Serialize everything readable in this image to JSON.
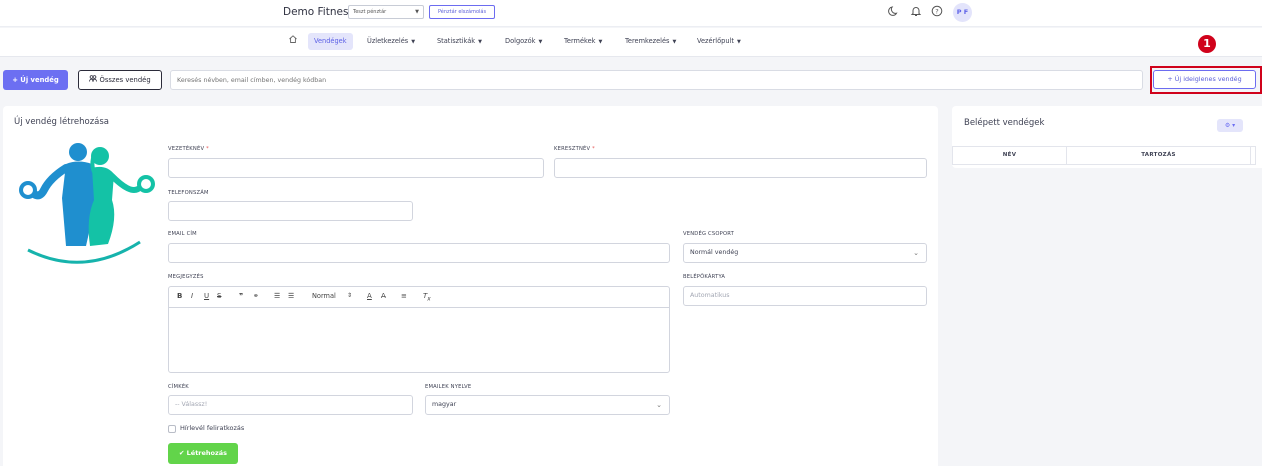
{
  "header": {
    "brand": "Demo Fitness",
    "cash_register": "Teszt pénztár",
    "cash_register_button": "Pénztár elszámolás",
    "avatar_initials": "P F"
  },
  "nav": {
    "items": [
      {
        "label": "Vendégek",
        "active": true
      },
      {
        "label": "Üzletkezelés"
      },
      {
        "label": "Statisztikák"
      },
      {
        "label": "Dolgozók"
      },
      {
        "label": "Termékek"
      },
      {
        "label": "Teremkezelés"
      },
      {
        "label": "Vezérlőpult"
      }
    ]
  },
  "actions": {
    "new_guest": "+ Új vendég",
    "all_guests": "Összes vendég",
    "search_placeholder": "Keresés névben, email címben, vendég kódban",
    "new_temp_guest": "+ Új ideiglenes vendég",
    "marker": "1"
  },
  "form": {
    "title": "Új vendég létrehozása",
    "lastname_label": "VEZETÉKNÉV",
    "firstname_label": "KERESZTNÉV",
    "phone_label": "TELEFONSZÁM",
    "email_label": "EMAIL CÍM",
    "group_label": "VENDÉG CSOPORT",
    "group_value": "Normál vendég",
    "note_label": "MEGJEGYZÉS",
    "card_label": "BELÉPŐKÁRTYA",
    "card_placeholder": "Automatikus",
    "editor_format": "Normal",
    "tags_label": "CÍMKÉK",
    "tags_placeholder": "-- Válassz!",
    "language_label": "EMAILEK NYELVE",
    "language_value": "magyar",
    "newsletter_label": "Hírlevél feliratkozás",
    "submit": "✔ Létrehozás"
  },
  "checked_in": {
    "title": "Belépett vendégek",
    "columns": [
      "NÉV",
      "TARTOZÁS"
    ]
  },
  "colors": {
    "accent": "#6c6ff2",
    "create": "#62d44a",
    "highlight": "#d0021b"
  }
}
